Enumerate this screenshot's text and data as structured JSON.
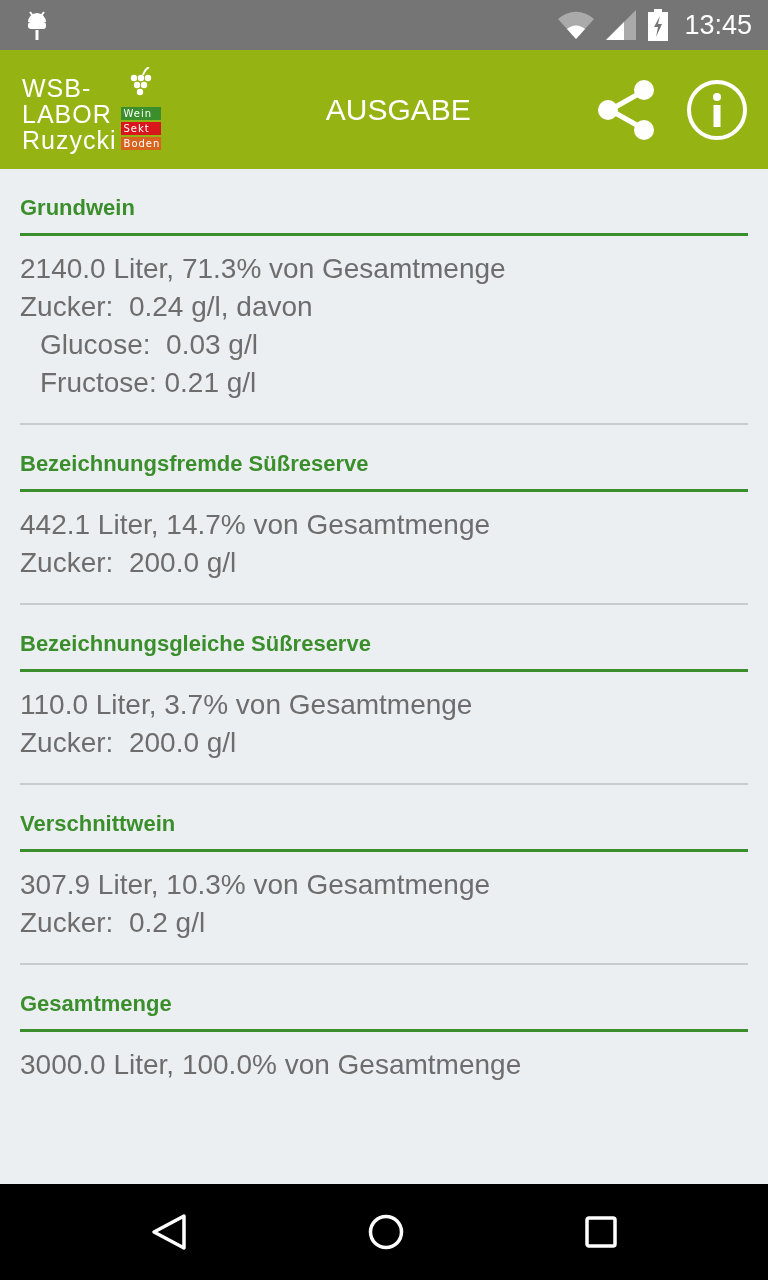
{
  "status_bar": {
    "time": "13:45"
  },
  "app_bar": {
    "logo": {
      "lines": [
        "WSB-",
        "LABOR",
        "Ruzycki"
      ],
      "tags": [
        {
          "label": "Wein",
          "color": "#3a8f2c"
        },
        {
          "label": "Sekt",
          "color": "#d8161c"
        },
        {
          "label": "Boden",
          "color": "#d6641e"
        }
      ]
    },
    "title": "AUSGABE"
  },
  "sections": [
    {
      "title": "Grundwein",
      "lines": [
        {
          "kind": "main",
          "text": "2140.0 Liter, 71.3% von Gesamtmenge"
        },
        {
          "kind": "main",
          "text": "Zucker:  0.24 g/l, davon"
        },
        {
          "kind": "sub",
          "text": "Glucose:  0.03 g/l"
        },
        {
          "kind": "sub",
          "text": "Fructose: 0.21 g/l"
        }
      ]
    },
    {
      "title": "Bezeichnungsfremde Süßreserve",
      "lines": [
        {
          "kind": "main",
          "text": "442.1 Liter, 14.7% von Gesamtmenge"
        },
        {
          "kind": "main",
          "text": "Zucker:  200.0 g/l"
        }
      ]
    },
    {
      "title": "Bezeichnungsgleiche Süßreserve",
      "lines": [
        {
          "kind": "main",
          "text": "110.0 Liter, 3.7% von Gesamtmenge"
        },
        {
          "kind": "main",
          "text": "Zucker:  200.0 g/l"
        }
      ]
    },
    {
      "title": "Verschnittwein",
      "lines": [
        {
          "kind": "main",
          "text": "307.9 Liter, 10.3% von Gesamtmenge"
        },
        {
          "kind": "main",
          "text": "Zucker:  0.2 g/l"
        }
      ]
    },
    {
      "title": "Gesamtmenge",
      "lines": [
        {
          "kind": "main",
          "text": "3000.0 Liter, 100.0% von Gesamtmenge"
        }
      ]
    }
  ]
}
